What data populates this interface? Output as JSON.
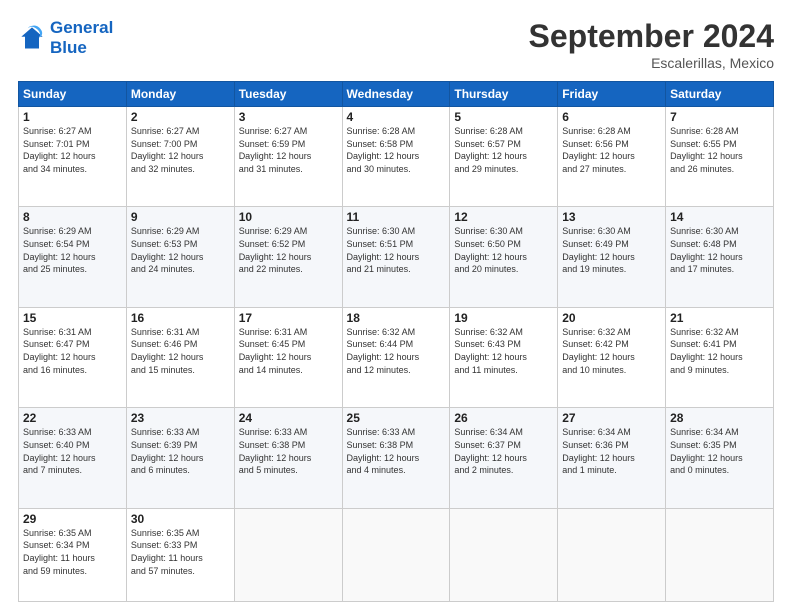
{
  "header": {
    "logo_line1": "General",
    "logo_line2": "Blue",
    "month_title": "September 2024",
    "location": "Escalerillas, Mexico"
  },
  "weekdays": [
    "Sunday",
    "Monday",
    "Tuesday",
    "Wednesday",
    "Thursday",
    "Friday",
    "Saturday"
  ],
  "weeks": [
    [
      {
        "day": "1",
        "info": "Sunrise: 6:27 AM\nSunset: 7:01 PM\nDaylight: 12 hours\nand 34 minutes."
      },
      {
        "day": "2",
        "info": "Sunrise: 6:27 AM\nSunset: 7:00 PM\nDaylight: 12 hours\nand 32 minutes."
      },
      {
        "day": "3",
        "info": "Sunrise: 6:27 AM\nSunset: 6:59 PM\nDaylight: 12 hours\nand 31 minutes."
      },
      {
        "day": "4",
        "info": "Sunrise: 6:28 AM\nSunset: 6:58 PM\nDaylight: 12 hours\nand 30 minutes."
      },
      {
        "day": "5",
        "info": "Sunrise: 6:28 AM\nSunset: 6:57 PM\nDaylight: 12 hours\nand 29 minutes."
      },
      {
        "day": "6",
        "info": "Sunrise: 6:28 AM\nSunset: 6:56 PM\nDaylight: 12 hours\nand 27 minutes."
      },
      {
        "day": "7",
        "info": "Sunrise: 6:28 AM\nSunset: 6:55 PM\nDaylight: 12 hours\nand 26 minutes."
      }
    ],
    [
      {
        "day": "8",
        "info": "Sunrise: 6:29 AM\nSunset: 6:54 PM\nDaylight: 12 hours\nand 25 minutes."
      },
      {
        "day": "9",
        "info": "Sunrise: 6:29 AM\nSunset: 6:53 PM\nDaylight: 12 hours\nand 24 minutes."
      },
      {
        "day": "10",
        "info": "Sunrise: 6:29 AM\nSunset: 6:52 PM\nDaylight: 12 hours\nand 22 minutes."
      },
      {
        "day": "11",
        "info": "Sunrise: 6:30 AM\nSunset: 6:51 PM\nDaylight: 12 hours\nand 21 minutes."
      },
      {
        "day": "12",
        "info": "Sunrise: 6:30 AM\nSunset: 6:50 PM\nDaylight: 12 hours\nand 20 minutes."
      },
      {
        "day": "13",
        "info": "Sunrise: 6:30 AM\nSunset: 6:49 PM\nDaylight: 12 hours\nand 19 minutes."
      },
      {
        "day": "14",
        "info": "Sunrise: 6:30 AM\nSunset: 6:48 PM\nDaylight: 12 hours\nand 17 minutes."
      }
    ],
    [
      {
        "day": "15",
        "info": "Sunrise: 6:31 AM\nSunset: 6:47 PM\nDaylight: 12 hours\nand 16 minutes."
      },
      {
        "day": "16",
        "info": "Sunrise: 6:31 AM\nSunset: 6:46 PM\nDaylight: 12 hours\nand 15 minutes."
      },
      {
        "day": "17",
        "info": "Sunrise: 6:31 AM\nSunset: 6:45 PM\nDaylight: 12 hours\nand 14 minutes."
      },
      {
        "day": "18",
        "info": "Sunrise: 6:32 AM\nSunset: 6:44 PM\nDaylight: 12 hours\nand 12 minutes."
      },
      {
        "day": "19",
        "info": "Sunrise: 6:32 AM\nSunset: 6:43 PM\nDaylight: 12 hours\nand 11 minutes."
      },
      {
        "day": "20",
        "info": "Sunrise: 6:32 AM\nSunset: 6:42 PM\nDaylight: 12 hours\nand 10 minutes."
      },
      {
        "day": "21",
        "info": "Sunrise: 6:32 AM\nSunset: 6:41 PM\nDaylight: 12 hours\nand 9 minutes."
      }
    ],
    [
      {
        "day": "22",
        "info": "Sunrise: 6:33 AM\nSunset: 6:40 PM\nDaylight: 12 hours\nand 7 minutes."
      },
      {
        "day": "23",
        "info": "Sunrise: 6:33 AM\nSunset: 6:39 PM\nDaylight: 12 hours\nand 6 minutes."
      },
      {
        "day": "24",
        "info": "Sunrise: 6:33 AM\nSunset: 6:38 PM\nDaylight: 12 hours\nand 5 minutes."
      },
      {
        "day": "25",
        "info": "Sunrise: 6:33 AM\nSunset: 6:38 PM\nDaylight: 12 hours\nand 4 minutes."
      },
      {
        "day": "26",
        "info": "Sunrise: 6:34 AM\nSunset: 6:37 PM\nDaylight: 12 hours\nand 2 minutes."
      },
      {
        "day": "27",
        "info": "Sunrise: 6:34 AM\nSunset: 6:36 PM\nDaylight: 12 hours\nand 1 minute."
      },
      {
        "day": "28",
        "info": "Sunrise: 6:34 AM\nSunset: 6:35 PM\nDaylight: 12 hours\nand 0 minutes."
      }
    ],
    [
      {
        "day": "29",
        "info": "Sunrise: 6:35 AM\nSunset: 6:34 PM\nDaylight: 11 hours\nand 59 minutes."
      },
      {
        "day": "30",
        "info": "Sunrise: 6:35 AM\nSunset: 6:33 PM\nDaylight: 11 hours\nand 57 minutes."
      },
      {
        "day": "",
        "info": ""
      },
      {
        "day": "",
        "info": ""
      },
      {
        "day": "",
        "info": ""
      },
      {
        "day": "",
        "info": ""
      },
      {
        "day": "",
        "info": ""
      }
    ]
  ]
}
